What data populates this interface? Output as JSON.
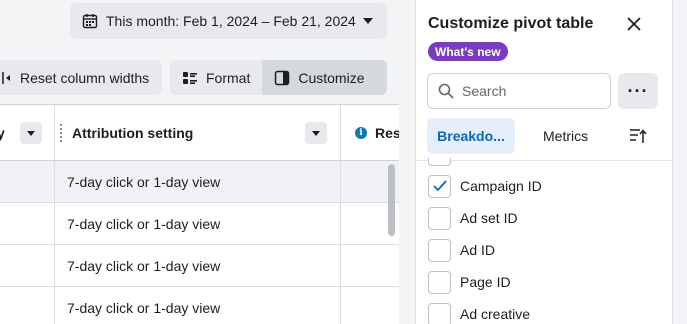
{
  "date_range": {
    "label": "This month: Feb 1, 2024 – Feb 21, 2024"
  },
  "toolbar": {
    "reset_label": "Reset column widths",
    "format_label": "Format",
    "customize_label": "Customize"
  },
  "table": {
    "columns": [
      {
        "label": "y"
      },
      {
        "label": "Attribution setting"
      },
      {
        "label": "Res"
      }
    ],
    "rows": [
      {
        "attribution": "7-day click or 1-day view",
        "selected": true
      },
      {
        "attribution": "7-day click or 1-day view",
        "selected": false
      },
      {
        "attribution": "7-day click or 1-day view",
        "selected": false
      },
      {
        "attribution": "7-day click or 1-day view",
        "selected": false
      }
    ]
  },
  "panel": {
    "title": "Customize pivot table",
    "badge": "What's new",
    "search_placeholder": "Search",
    "more_label": "···",
    "tabs": [
      {
        "label": "Breakdo...",
        "active": true
      },
      {
        "label": "Metrics",
        "active": false
      },
      {
        "icon": "sort-icon"
      }
    ],
    "options": [
      {
        "label": "Campaign ID",
        "checked": true
      },
      {
        "label": "Ad set ID",
        "checked": false
      },
      {
        "label": "Ad ID",
        "checked": false
      },
      {
        "label": "Page ID",
        "checked": false
      },
      {
        "label": "Ad creative",
        "checked": false
      }
    ]
  },
  "colors": {
    "accent": "#0a66c2",
    "badge": "#7a3dc1",
    "info": "#0a78be"
  }
}
